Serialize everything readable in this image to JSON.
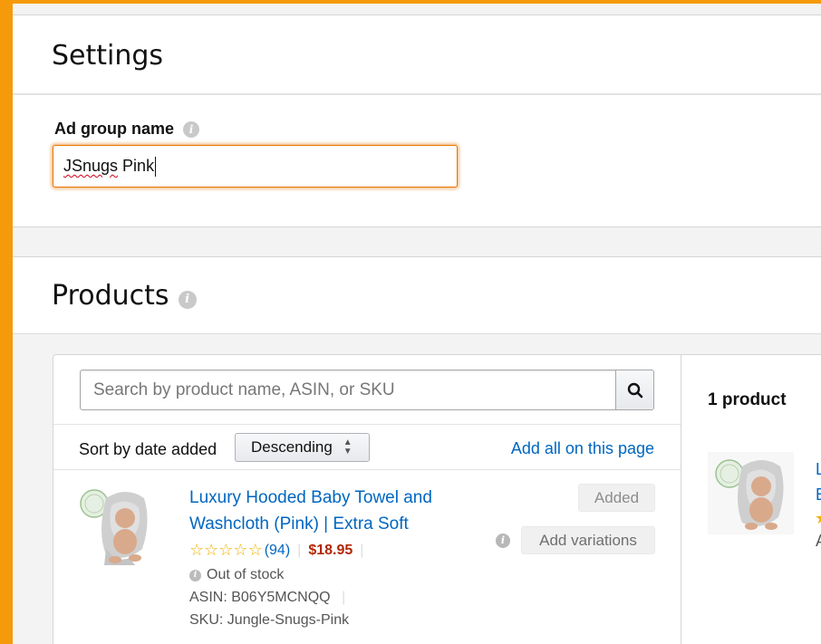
{
  "settings": {
    "title": "Settings",
    "ad_group_label": "Ad group name",
    "ad_group_value_misspelled": "JSnugs",
    "ad_group_value_rest": " Pink"
  },
  "products": {
    "title": "Products",
    "search_placeholder": "Search by product name, ASIN, or SKU",
    "sort_label": "Sort by date added",
    "sort_value": "Descending",
    "add_all_label": "Add all on this page",
    "item": {
      "title_line1": "Luxury Hooded Baby Towel and",
      "title_line2": "Washcloth (Pink) | Extra Soft",
      "rating": 5,
      "rating_count": "(94)",
      "price": "$18.95",
      "stock": "Out of stock",
      "asin": "ASIN: B06Y5MCNQQ",
      "sku": "SKU: Jungle-Snugs-Pink",
      "added_label": "Added",
      "variations_label": "Add variations"
    },
    "selected": {
      "count_label": "1 product",
      "partial_line1": "L",
      "partial_line2": "E",
      "partial_line4": "A"
    }
  },
  "colors": {
    "accent": "#f59a0a",
    "link": "#0066c0",
    "price": "#b12704",
    "star": "#f0b000"
  },
  "icons": [
    "info-icon",
    "search-icon",
    "sort-updown-icon",
    "star-icon",
    "product-thumbnail"
  ]
}
